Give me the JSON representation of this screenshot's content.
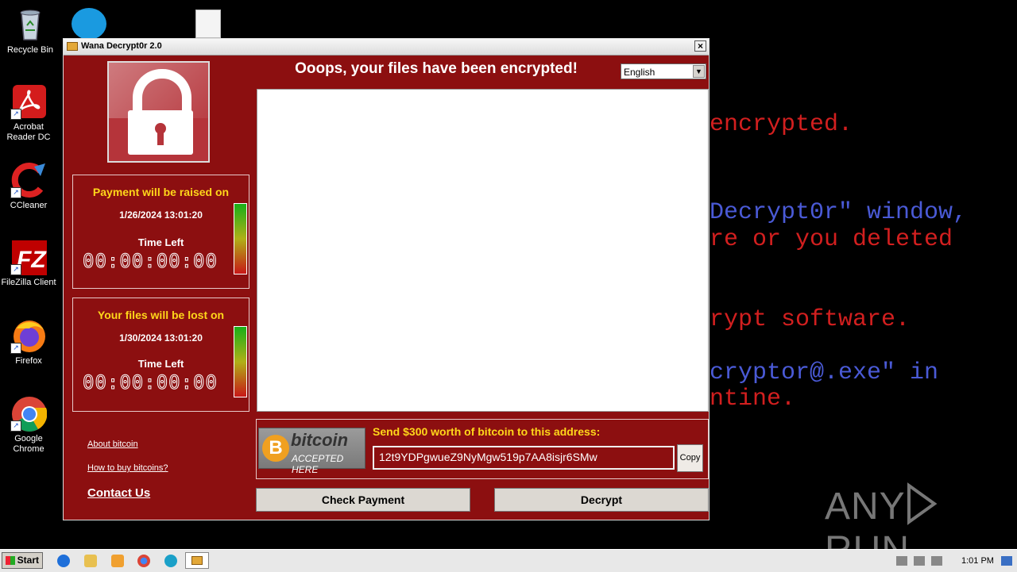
{
  "background_text": [
    {
      "text": "encrypted.",
      "color": "red"
    },
    {
      "text": "Decrypt0r\" window,",
      "color": "blue"
    },
    {
      "text": "re or you deleted",
      "color": "red"
    },
    {
      "text": "rypt software.",
      "color": "red"
    },
    {
      "text": "cryptor@.exe\" in",
      "color": "blue"
    },
    {
      "text": "ntine.",
      "color": "red"
    }
  ],
  "desktop": {
    "icons": [
      {
        "label": "Recycle Bin",
        "icon": "recycle-bin-icon"
      },
      {
        "label": "Acrobat Reader DC",
        "icon": "acrobat-icon"
      },
      {
        "label": "CCleaner",
        "icon": "ccleaner-icon"
      },
      {
        "label": "FileZilla Client",
        "icon": "filezilla-icon"
      },
      {
        "label": "Firefox",
        "icon": "firefox-icon"
      },
      {
        "label": "Google Chrome",
        "icon": "chrome-icon"
      }
    ]
  },
  "window": {
    "title": "Wana Decrypt0r 2.0",
    "close_label": "×",
    "headline": "Ooops, your files have been encrypted!",
    "language": "English",
    "panel1": {
      "heading": "Payment will be raised on",
      "date": "1/26/2024 13:01:20",
      "time_left_label": "Time Left",
      "timer": "00:00:00:00"
    },
    "panel2": {
      "heading": "Your files will be lost on",
      "date": "1/30/2024 13:01:20",
      "time_left_label": "Time Left",
      "timer": "00:00:00:00"
    },
    "links": {
      "about_bitcoin": "About bitcoin",
      "how_to_buy": "How to buy bitcoins?",
      "contact": "Contact Us"
    },
    "bitcoin_logo": {
      "word": "bitcoin",
      "sub": "ACCEPTED HERE",
      "symbol": "B"
    },
    "send_text": "Send $300 worth of bitcoin to this address:",
    "address": "12t9YDPgwueZ9NyMgw519p7AA8isjr6SMw",
    "copy_label": "Copy",
    "check_payment_label": "Check Payment",
    "decrypt_label": "Decrypt"
  },
  "taskbar": {
    "start_label": "Start",
    "clock": "1:01 PM"
  },
  "watermark": {
    "left": "ANY",
    "right": "RUN"
  },
  "colors": {
    "window_bg": "#8c0f10",
    "heading_yellow": "#ffd71a",
    "bg_red_text": "#d21f1f",
    "bg_blue_text": "#4a5ad6"
  }
}
